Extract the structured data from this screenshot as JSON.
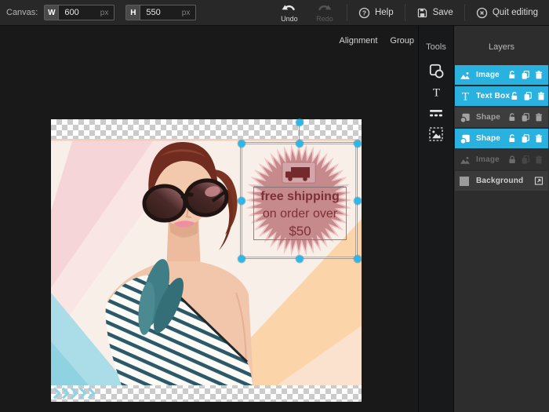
{
  "topbar": {
    "canvas_label": "Canvas:",
    "width_field": {
      "label": "W",
      "value": "600",
      "unit": "px"
    },
    "height_field": {
      "label": "H",
      "value": "550",
      "unit": "px"
    },
    "undo": "Undo",
    "redo": "Redo",
    "help": "Help",
    "save": "Save",
    "quit": "Quit editing",
    "icons": [
      "undo-arrow-icon",
      "redo-arrow-icon",
      "help-circle-icon",
      "save-floppy-icon",
      "quit-circle-icon"
    ]
  },
  "context_bar": {
    "alignment": "Alignment",
    "group": "Group"
  },
  "tools_panel": {
    "title": "Tools",
    "tools": [
      {
        "name": "shape-tool",
        "icon": "shapes-icon"
      },
      {
        "name": "text-tool",
        "icon": "text-icon"
      },
      {
        "name": "lines-tool",
        "icon": "lines-icon"
      },
      {
        "name": "image-tool",
        "icon": "image-frame-icon"
      }
    ]
  },
  "layers_panel": {
    "title": "Layers",
    "layers": [
      {
        "label": "Image",
        "icon": "image-icon",
        "state": "selected",
        "actions": [
          "unlock-icon",
          "duplicate-icon",
          "trash-icon"
        ]
      },
      {
        "label": "Text Box",
        "icon": "text-icon",
        "state": "selected",
        "actions": [
          "unlock-icon",
          "duplicate-icon",
          "trash-icon"
        ]
      },
      {
        "label": "Shape",
        "icon": "shape-icon",
        "state": "normal",
        "actions": [
          "unlock-icon",
          "duplicate-icon",
          "trash-icon"
        ]
      },
      {
        "label": "Shape",
        "icon": "shape-icon",
        "state": "selected",
        "actions": [
          "unlock-icon",
          "duplicate-icon",
          "trash-icon"
        ]
      },
      {
        "label": "Image",
        "icon": "image-icon",
        "state": "disabled",
        "actions": [
          "lock-icon",
          "duplicate-icon",
          "trash-icon"
        ]
      },
      {
        "label": "Background",
        "icon": "swatch-icon",
        "state": "background",
        "actions": [
          "resize-icon"
        ]
      }
    ]
  },
  "canvas": {
    "badge": {
      "line1": "free shipping",
      "line2": "on order over",
      "line3": "$50",
      "icon": "truck-icon"
    },
    "colors": {
      "selection_handle": "#2bb7ea",
      "layer_selected": "#29b1e0",
      "badge_fill": "#c4878a",
      "badge_halo": "#efc6c6",
      "badge_text": "#7c3136",
      "checker": "#cbcbcb"
    }
  }
}
